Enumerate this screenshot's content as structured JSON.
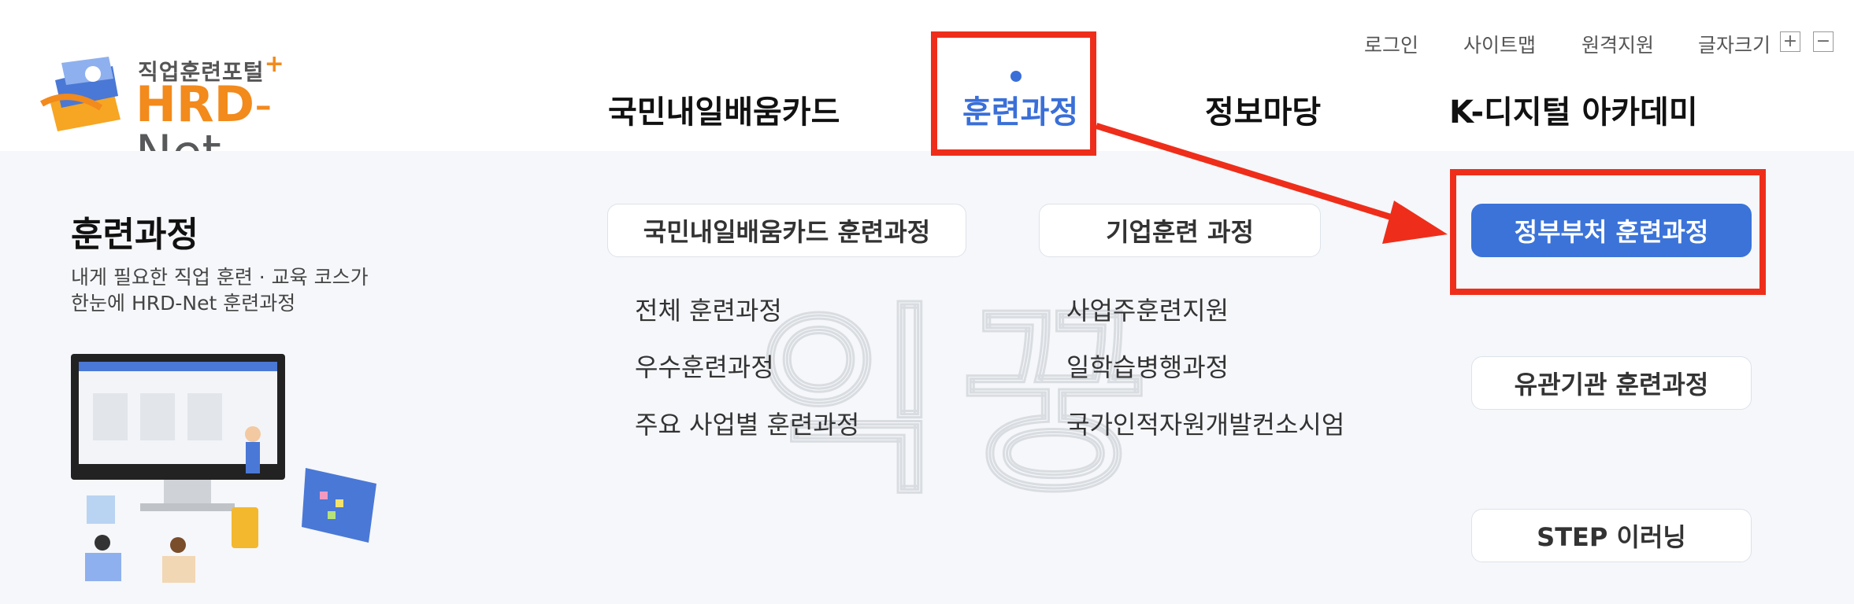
{
  "logo": {
    "small_text": "직업훈련포털",
    "plus": "+",
    "hrd": "HRD",
    "dash": "-",
    "net": "Net"
  },
  "utility": {
    "login": "로그인",
    "sitemap": "사이트맵",
    "remote": "원격지원",
    "fontsize": "글자크기",
    "plus": "+",
    "minus": "−"
  },
  "gnb": [
    "국민내일배움카드",
    "훈련과정",
    "정보마당",
    "K-디지털 아카데미"
  ],
  "panel": {
    "title": "훈련과정",
    "desc1": "내게 필요한 직업 훈련 · 교육 코스가",
    "desc2": "한눈에 HRD-Net 훈련과정",
    "col1": {
      "header": "국민내일배움카드 훈련과정",
      "links": [
        "전체 훈련과정",
        "우수훈련과정",
        "주요 사업별 훈련과정"
      ]
    },
    "col2": {
      "header": "기업훈련 과정",
      "links": [
        "사업주훈련지원",
        "일학습병행과정",
        "국가인적자원개발컨소시엄"
      ]
    },
    "col3": [
      "정부부처 훈련과정",
      "유관기관 훈련과정",
      "STEP 이러닝"
    ]
  },
  "watermark": "익꿍",
  "colors": {
    "accent": "#3b73d9",
    "highlight": "#ee2e1a",
    "logo_orange": "#f28a1c"
  }
}
